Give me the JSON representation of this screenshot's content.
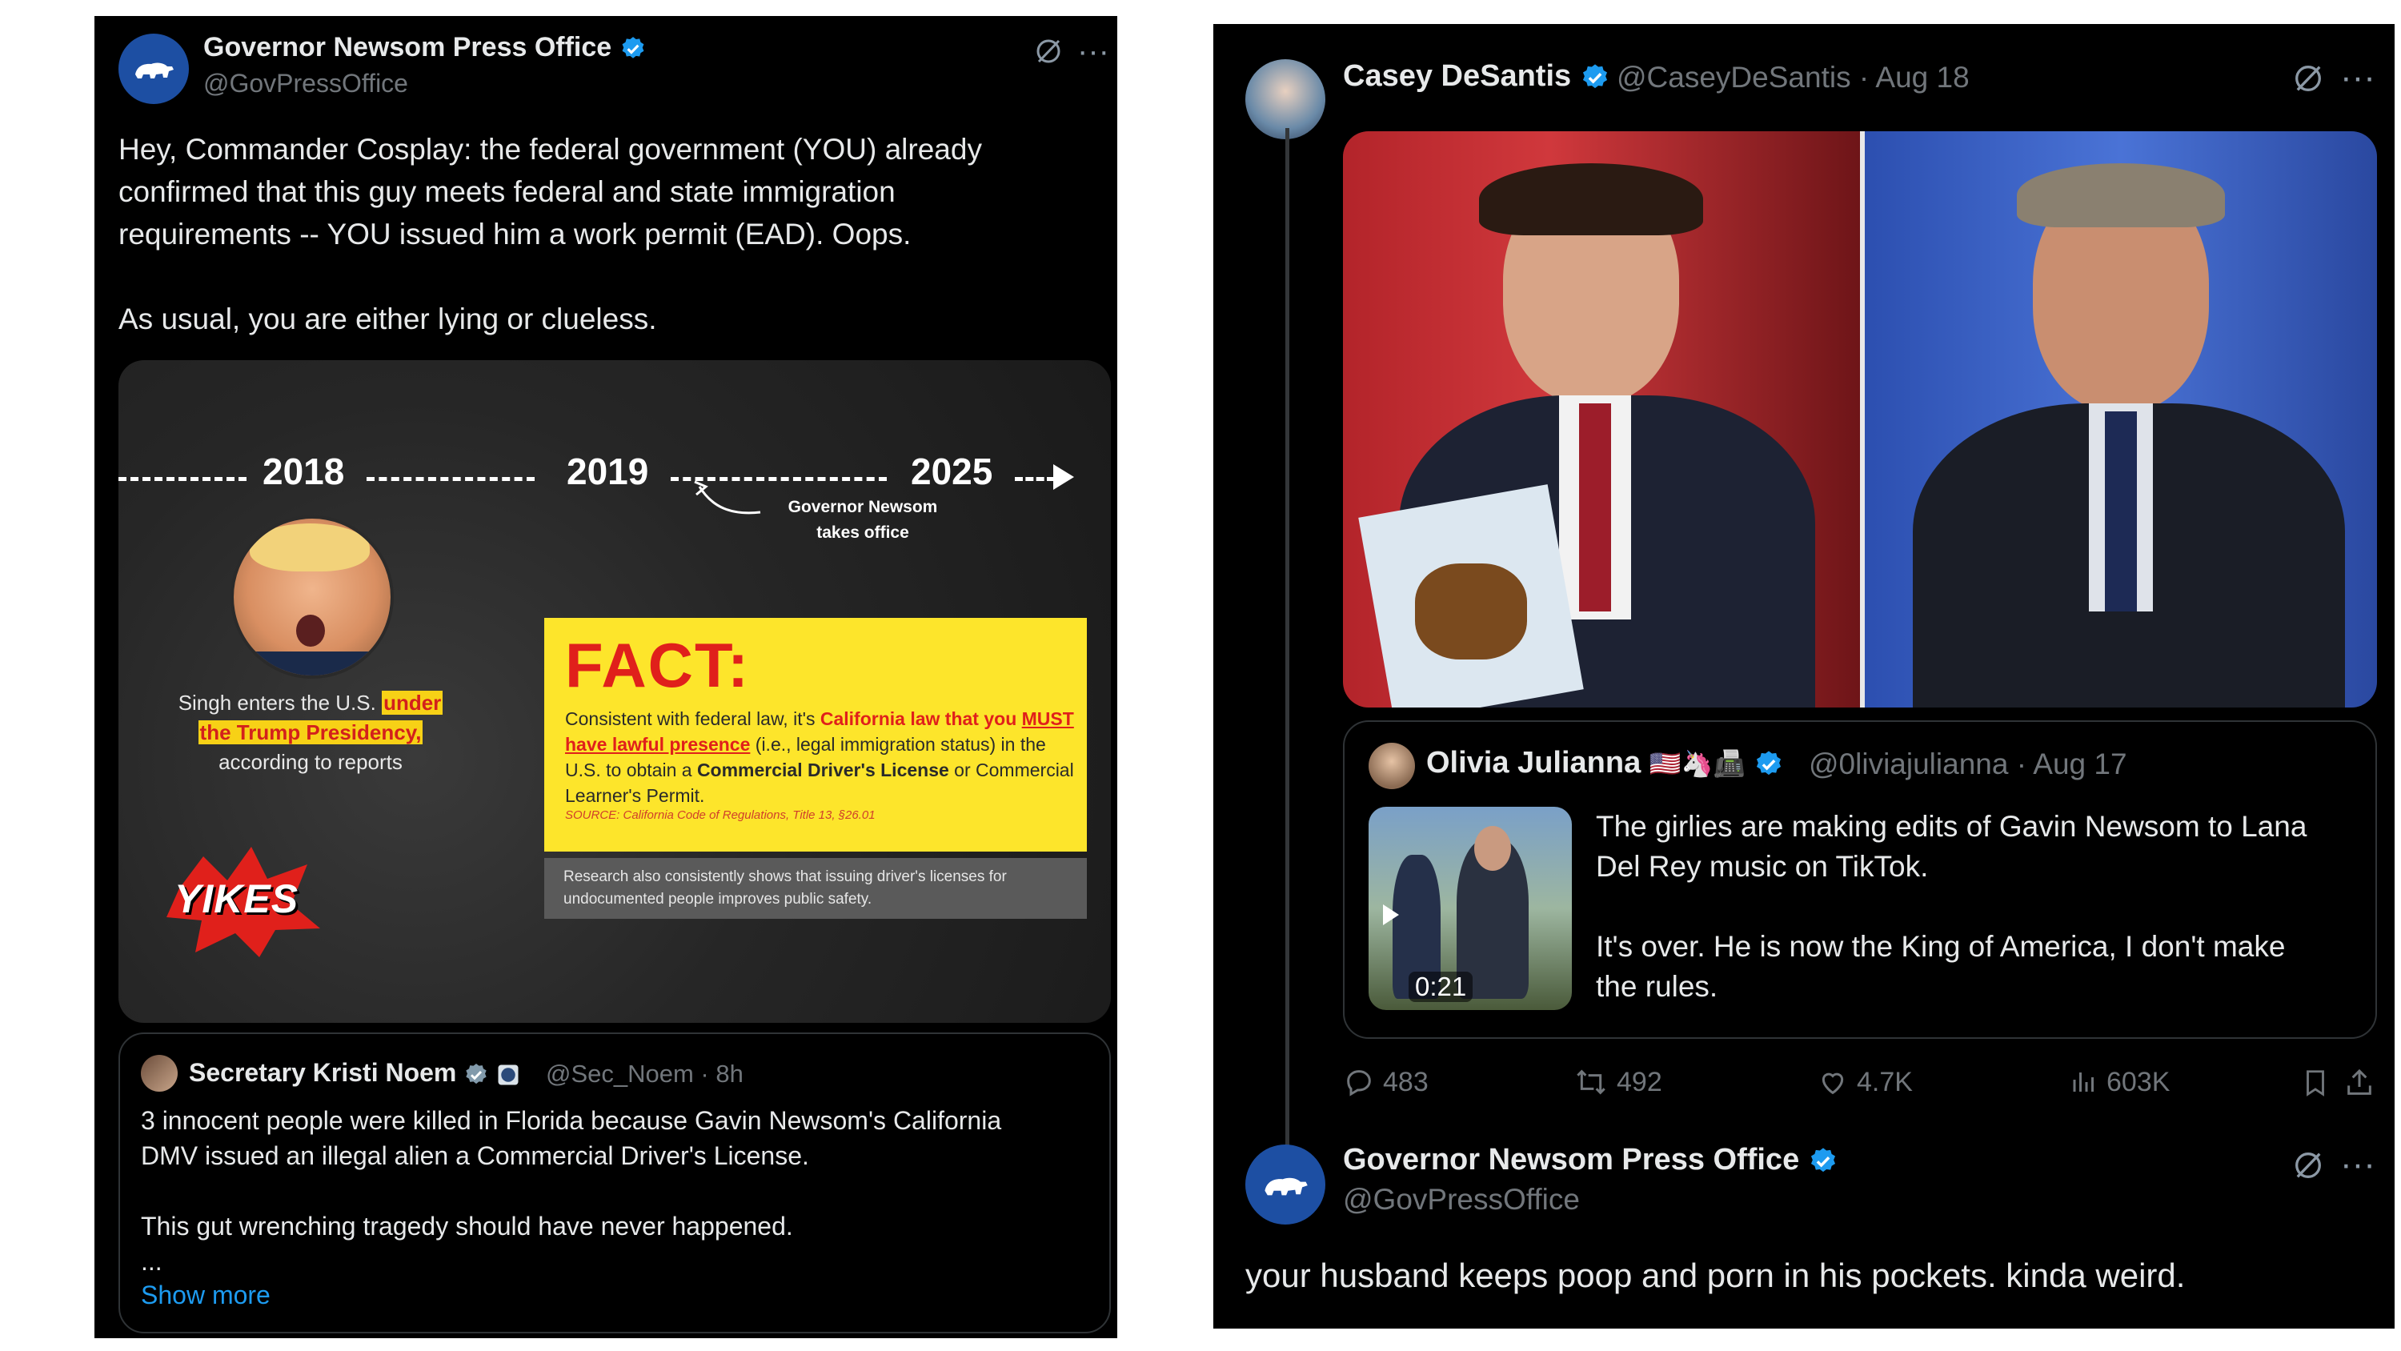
{
  "left_tweet": {
    "author": "Governor Newsom Press Office",
    "handle": "@GovPressOffice",
    "text": "Hey, Commander Cosplay: the federal government (YOU) already\nconfirmed that this guy meets federal and state immigration\nrequirements -- YOU issued him a work permit (EAD). Oops.\n\nAs usual, you are either lying or clueless.",
    "infographic": {
      "year1": "2018",
      "year2": "2019",
      "year3": "2025",
      "arrow_note": "Governor Newsom\ntakes office",
      "singh_pre": "Singh enters the U.S.",
      "singh_hl1": "under",
      "singh_hl2": "the Trump Presidency,",
      "singh_post": "according to reports",
      "yikes": "YIKES",
      "fact_title": "FACT:",
      "fact_p1": "Consistent with federal law, it's ",
      "fact_red1": "California law that you ",
      "fact_red2": "MUST have lawful presence",
      "fact_p2": " (i.e., legal immigration status) in the U.S. to obtain a ",
      "fact_b1": "Commercial Driver's License",
      "fact_p3": " or Commercial Learner's Permit.",
      "fact_source": "SOURCE: California Code of Regulations, Title 13, §26.01",
      "research": "Research also consistently shows that issuing driver's licenses for undocumented people improves public safety."
    },
    "quote": {
      "author": "Secretary Kristi Noem",
      "handle": "@Sec_Noem · 8h",
      "text": "3 innocent people were killed in Florida because Gavin Newsom's California\nDMV issued an illegal alien a Commercial Driver's License.\n\nThis gut wrenching tragedy should have never happened.\n...",
      "show_more": "Show more"
    }
  },
  "right_tweet": {
    "author": "Casey DeSantis",
    "handle": "@CaseyDeSantis · Aug 18",
    "quote": {
      "author": "Olivia Julianna",
      "emojis": "🇺🇸🦄📠",
      "handle": "@0liviajulianna · Aug 17",
      "video_duration": "0:21",
      "text": "The girlies are making edits of Gavin Newsom to Lana\nDel Rey music on TikTok.\n\nIt's over. He is now the King of America, I don't make\nthe rules."
    },
    "stats": {
      "replies": "483",
      "reposts": "492",
      "likes": "4.7K",
      "views": "603K"
    },
    "reply": {
      "author": "Governor Newsom Press Office",
      "handle": "@GovPressOffice",
      "text": "your husband keeps poop and porn in his pockets. kinda weird."
    }
  },
  "icons": [
    "bear-icon",
    "verified-icon",
    "grok-icon",
    "more-icon",
    "reply-icon",
    "repost-icon",
    "like-icon",
    "views-icon",
    "bookmark-icon",
    "share-icon",
    "play-icon"
  ],
  "colors": {
    "background": "#000000",
    "verified": "#1d9bf0",
    "muted": "#71767b",
    "link": "#1d9bf0",
    "fact_yellow": "#fde52b",
    "fact_red": "#e0201b"
  }
}
